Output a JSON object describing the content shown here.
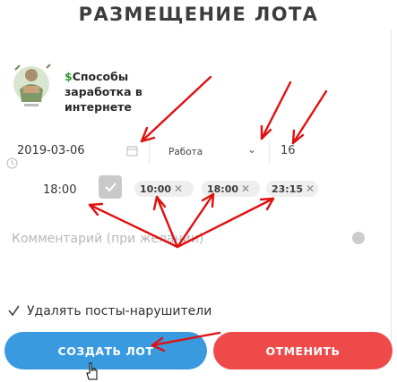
{
  "header": {
    "title": "РАЗМЕЩЕНИЕ ЛОТА"
  },
  "channel": {
    "name_prefix": "$",
    "name": "Способы заработка в интернете"
  },
  "form": {
    "date_value": "2019-03-06",
    "category_value": "Работа",
    "number_value": "16",
    "time_value": "18:00",
    "time_chips": [
      "10:00",
      "18:00",
      "23:15"
    ],
    "chip_remove_glyph": "✕",
    "comment_placeholder": "Комментарий (при желании)"
  },
  "options": {
    "delete_violators_label": "Удалять посты-нарушители",
    "delete_violators_checked": true
  },
  "actions": {
    "create_label": "СОЗДАТЬ ЛОТ",
    "cancel_label": "ОТМЕНИТЬ"
  },
  "colors": {
    "create": "#3a9ae0",
    "cancel": "#ee4a4a",
    "annotation": "#e01010"
  }
}
